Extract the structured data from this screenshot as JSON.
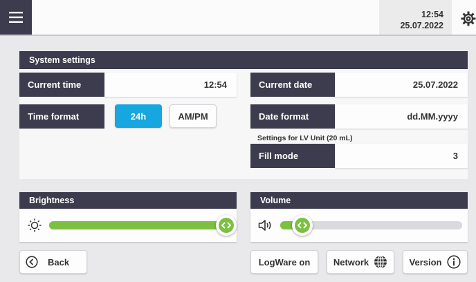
{
  "topbar": {
    "menu_icon": "hamburger-icon",
    "time": "12:54",
    "date": "25.07.2022",
    "settings_icon": "gear-icon"
  },
  "system": {
    "title": "System settings",
    "current_time_label": "Current time",
    "current_time_value": "12:54",
    "current_date_label": "Current date",
    "current_date_value": "25.07.2022",
    "time_format_label": "Time format",
    "time_format_options": [
      "24h",
      "AM/PM"
    ],
    "time_format_selected": "24h",
    "date_format_label": "Date format",
    "date_format_value": "dd.MM.yyyy",
    "lv_note": "Settings for LV Unit (20 mL)",
    "fill_mode_label": "Fill mode",
    "fill_mode_value": "3"
  },
  "brightness": {
    "title": "Brightness",
    "icon": "sun-icon",
    "level": 1.0
  },
  "volume": {
    "title": "Volume",
    "icon": "speaker-icon",
    "level": 0.12
  },
  "footer": {
    "back_label": "Back",
    "back_icon": "chevron-left-circle-icon",
    "logware_label": "LogWare on",
    "network_label": "Network",
    "network_icon": "globe-icon",
    "version_label": "Version",
    "version_icon": "info-icon"
  },
  "colors": {
    "header_dark": "#3c3c4e",
    "accent_blue": "#16a6e0",
    "slider_green": "#7cc041"
  }
}
